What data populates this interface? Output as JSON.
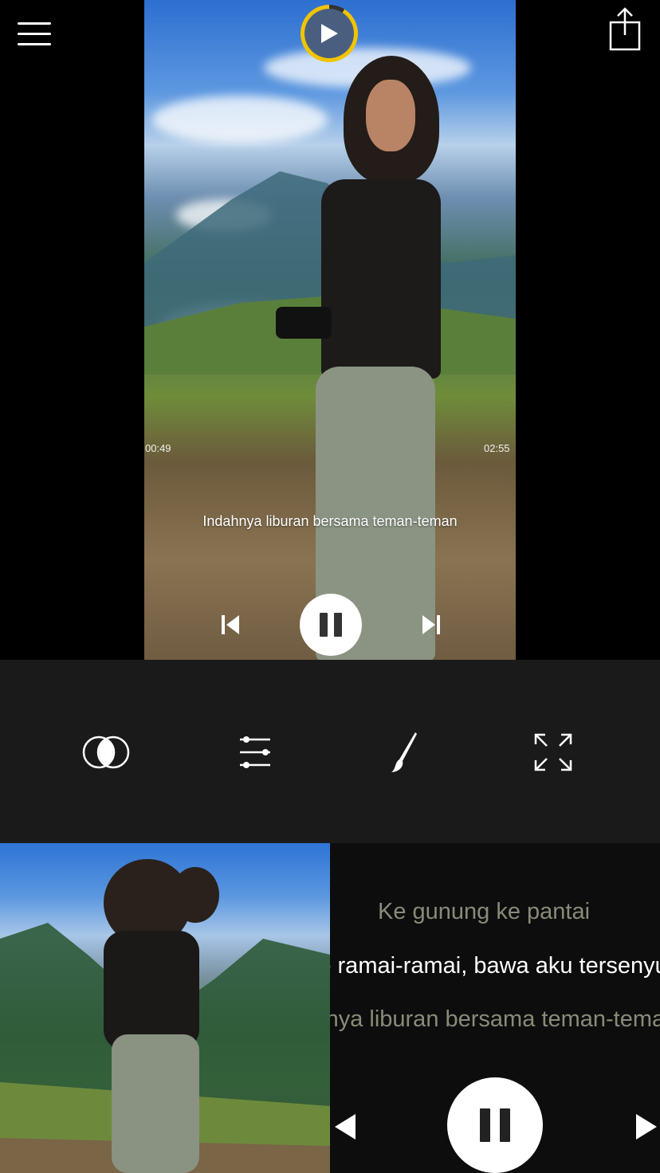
{
  "player": {
    "time_elapsed": "00:49",
    "time_total": "02:55",
    "caption": "Indahnya liburan bersama teman-teman",
    "progress": 0.28
  },
  "toolbar": {
    "tools": [
      "blend-icon",
      "adjust-icon",
      "brush-icon",
      "fullscreen-icon"
    ]
  },
  "lyrics": {
    "previous": "Ke gunung ke pantai",
    "current": "Ke ramai-ramai, bawa aku tersenyum",
    "next": "Indahnya liburan bersama teman-teman"
  },
  "colors": {
    "accent": "#f2c400",
    "toolbar_bg": "#1a1a1a",
    "lyric_inactive": "#8a8a7a",
    "lyric_active": "#ffffff"
  }
}
